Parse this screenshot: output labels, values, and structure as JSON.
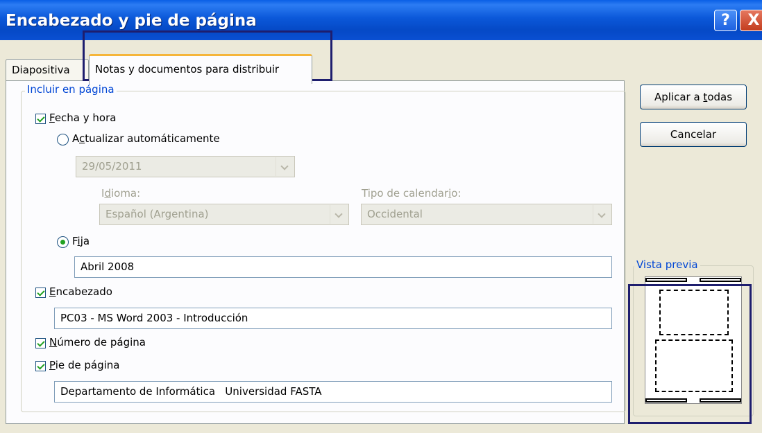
{
  "window": {
    "title": "Encabezado y pie de página",
    "help_label": "?",
    "close_label": "X"
  },
  "tabs": [
    {
      "label": "Diapositiva",
      "active": false
    },
    {
      "label": "Notas y documentos para distribuir",
      "active": true
    }
  ],
  "group": {
    "legend": "Incluir en página",
    "fecha_hora": {
      "checked": true,
      "mnemonic": "F",
      "rest": "echa y hora"
    },
    "actualizar": {
      "selected": false,
      "pre": "A",
      "mnemonic": "c",
      "rest": "tualizar automáticamente"
    },
    "fecha_value": "29/05/2011",
    "idioma": {
      "pre": "I",
      "mnemonic": "d",
      "rest": "ioma:",
      "value": "Español (Argentina)"
    },
    "calendario": {
      "pre": "Tipo de calendar",
      "mnemonic": "i",
      "rest": "o:",
      "value": "Occidental"
    },
    "fija": {
      "selected": true,
      "pre": "F",
      "mnemonic": "i",
      "rest": "ja",
      "value": "Abril 2008"
    },
    "encabezado": {
      "checked": true,
      "mnemonic": "E",
      "rest": "ncabezado",
      "value": "PC03 - MS Word 2003 - Introducción"
    },
    "numero_pagina": {
      "checked": true,
      "mnemonic": "N",
      "rest": "úmero de página"
    },
    "pie_pagina": {
      "checked": true,
      "mnemonic": "P",
      "rest": "ie de página",
      "value": "Departamento de Informática   Universidad FASTA"
    }
  },
  "buttons": {
    "aplicar": {
      "pre": "Aplicar a ",
      "mnemonic": "t",
      "rest": "odas"
    },
    "cancelar": "Cancelar"
  },
  "preview": {
    "legend": "Vista previa"
  },
  "colors": {
    "titlebar": "#0A4FD2",
    "dialog_bg": "#ECE9D8",
    "legend_text": "#0046D5",
    "active_tab_accent": "#F5B53A",
    "highlight_box": "#1E1E6E",
    "check_mark": "#21A121"
  }
}
